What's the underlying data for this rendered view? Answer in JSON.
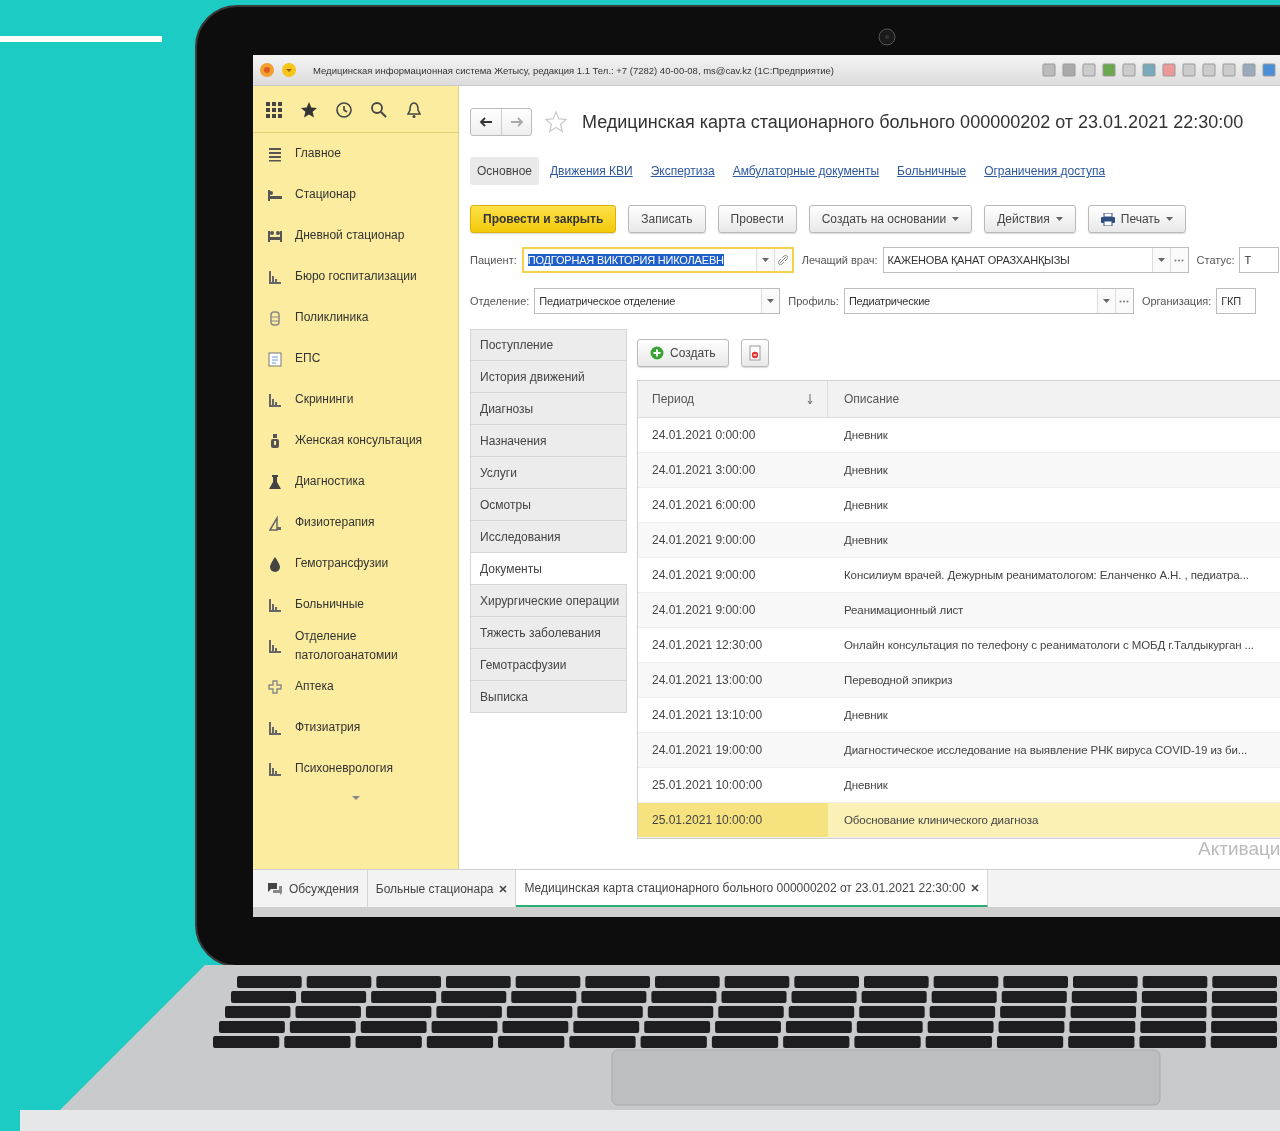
{
  "title_bar": {
    "title": "Медицинская информационная система Жетысу, редакция 1.1 Тел.: +7 (7282) 40-00-08, ms@cav.kz  (1С:Предприятие)"
  },
  "sidebar": {
    "items": [
      {
        "label": "Главное"
      },
      {
        "label": "Стационар"
      },
      {
        "label": "Дневной стационар"
      },
      {
        "label": "Бюро госпитализации"
      },
      {
        "label": "Поликлиника"
      },
      {
        "label": "ЕПС"
      },
      {
        "label": "Скрининги"
      },
      {
        "label": "Женская консультация"
      },
      {
        "label": "Диагностика"
      },
      {
        "label": "Физиотерапия"
      },
      {
        "label": "Гемотрансфузии"
      },
      {
        "label": "Больничные"
      },
      {
        "label": "Отделение патологоанатомии"
      },
      {
        "label": "Аптека"
      },
      {
        "label": "Фтизиатрия"
      },
      {
        "label": "Психоневрология"
      }
    ]
  },
  "form": {
    "title": "Медицинская карта стационарного больного 000000202 от 23.01.2021 22:30:00",
    "tabs": [
      {
        "label": "Основное",
        "selected": true
      },
      {
        "label": "Движения КВИ",
        "selected": false
      },
      {
        "label": "Экспертиза",
        "selected": false
      },
      {
        "label": "Амбулаторные документы",
        "selected": false
      },
      {
        "label": "Больничные",
        "selected": false
      },
      {
        "label": "Ограничения доступа",
        "selected": false
      }
    ],
    "buttons": [
      {
        "label": "Провести и закрыть",
        "kind": "primary"
      },
      {
        "label": "Записать",
        "kind": "plain"
      },
      {
        "label": "Провести",
        "kind": "plain"
      },
      {
        "label": "Создать на основании",
        "kind": "dropdown"
      },
      {
        "label": "Действия",
        "kind": "dropdown"
      },
      {
        "label": "Печать",
        "kind": "print"
      }
    ],
    "field_rows": [
      {
        "fields": [
          {
            "label": "Пациент:",
            "value": "ПОДГОРНАЯ ВИКТОРИЯ НИКОЛАЕВН",
            "focused": true,
            "dropdown": true,
            "open_button": false,
            "link_button": true
          },
          {
            "label": "Лечащий врач:",
            "value": "КАЖЕНОВА ҚАНАТ ОРАЗХАНҚЫЗЫ",
            "focused": false,
            "dropdown": true,
            "open_button": true,
            "link_button": false
          },
          {
            "label": "Статус:",
            "value": "Т",
            "focused": false,
            "dropdown": false,
            "open_button": false,
            "link_button": false
          }
        ]
      },
      {
        "fields": [
          {
            "label": "Отделение:",
            "value": "Педиатрическое отделение",
            "focused": false,
            "dropdown": true,
            "open_button": false,
            "link_button": false
          },
          {
            "label": "Профиль:",
            "value": "Педиатрические",
            "focused": false,
            "dropdown": true,
            "open_button": true,
            "link_button": false
          },
          {
            "label": "Организация:",
            "value": "ГКП",
            "focused": false,
            "dropdown": false,
            "open_button": false,
            "link_button": false
          }
        ]
      }
    ]
  },
  "sections": [
    {
      "label": "Поступление",
      "selected": false
    },
    {
      "label": "История движений",
      "selected": false
    },
    {
      "label": "Диагнозы",
      "selected": false
    },
    {
      "label": "Назначения",
      "selected": false
    },
    {
      "label": "Услуги",
      "selected": false
    },
    {
      "label": "Осмотры",
      "selected": false
    },
    {
      "label": "Исследования",
      "selected": false
    },
    {
      "label": "Документы",
      "selected": true
    },
    {
      "label": "Хирургические операции",
      "selected": false
    },
    {
      "label": "Тяжесть заболевания",
      "selected": false
    },
    {
      "label": "Гемотрасфузии",
      "selected": false
    },
    {
      "label": "Выписка",
      "selected": false
    }
  ],
  "table": {
    "create_button": "Создать",
    "columns": [
      "Период",
      "Описание"
    ],
    "rows": [
      {
        "period": "24.01.2021 0:00:00",
        "description": "Дневник",
        "selected": false
      },
      {
        "period": "24.01.2021 3:00:00",
        "description": "Дневник",
        "selected": false
      },
      {
        "period": "24.01.2021 6:00:00",
        "description": "Дневник",
        "selected": false
      },
      {
        "period": "24.01.2021 9:00:00",
        "description": "Дневник",
        "selected": false
      },
      {
        "period": "24.01.2021 9:00:00",
        "description": "Консилиум врачей. Дежурным реаниматологом: Еланченко А.Н. , педиатра...",
        "selected": false
      },
      {
        "period": "24.01.2021 9:00:00",
        "description": "Реанимационный лист",
        "selected": false
      },
      {
        "period": "24.01.2021 12:30:00",
        "description": "Онлайн консультация по телефону с реаниматологи с МОБД г.Талдыкурган ...",
        "selected": false
      },
      {
        "period": "24.01.2021 13:00:00",
        "description": "Переводной эпикриз",
        "selected": false
      },
      {
        "period": "24.01.2021 13:10:00",
        "description": "Дневник",
        "selected": false
      },
      {
        "period": "24.01.2021 19:00:00",
        "description": "Диагностическое исследование на выявление РНК вируса COVID-19 из би...",
        "selected": false
      },
      {
        "period": "25.01.2021 10:00:00",
        "description": "Дневник",
        "selected": false
      },
      {
        "period": "25.01.2021 10:00:00",
        "description": "Обоснование клинического диагноза",
        "selected": true
      }
    ]
  },
  "activation_notice": "Активаци",
  "open_windows": [
    {
      "label": "Обсуждения",
      "selected": false,
      "closable": false
    },
    {
      "label": "Больные стационара",
      "selected": false,
      "closable": true
    },
    {
      "label": "Медицинская карта стационарного больного 000000202 от 23.01.2021 22:30:00",
      "selected": true,
      "closable": true
    }
  ]
}
